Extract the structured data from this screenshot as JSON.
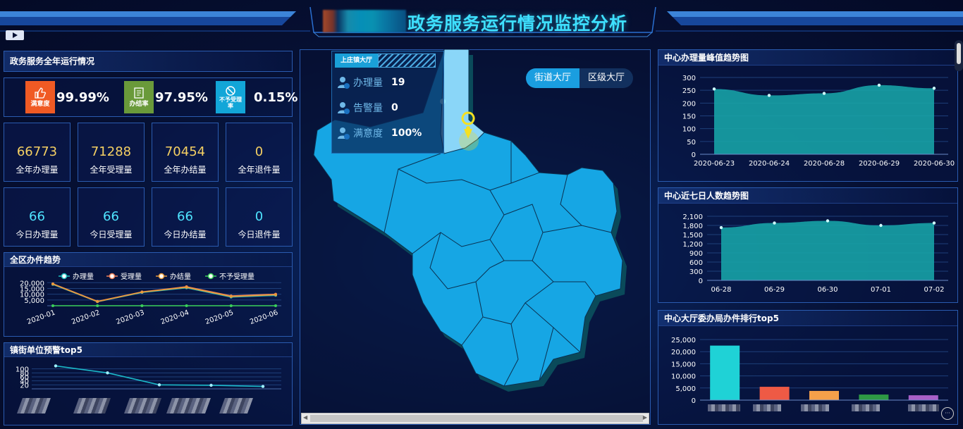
{
  "header": {
    "title": "政务服务运行情况监控分析"
  },
  "left": {
    "year_panel_title": "政务服务全年运行情况",
    "kpis": [
      {
        "label": "满意度",
        "value": "99.99%",
        "color": "#f05a24"
      },
      {
        "label": "办结率",
        "value": "97.95%",
        "color": "#6a9a3a"
      },
      {
        "label": "不予受理率",
        "value": "0.15%",
        "color": "#12a6d8"
      }
    ],
    "year_stats": [
      {
        "value": "66773",
        "label": "全年办理量"
      },
      {
        "value": "71288",
        "label": "全年受理量"
      },
      {
        "value": "70454",
        "label": "全年办结量"
      },
      {
        "value": "0",
        "label": "全年退件量"
      }
    ],
    "today_stats": [
      {
        "value": "66",
        "label": "今日办理量"
      },
      {
        "value": "66",
        "label": "今日受理量"
      },
      {
        "value": "66",
        "label": "今日办结量"
      },
      {
        "value": "0",
        "label": "今日退件量"
      }
    ],
    "trend_panel_title": "全区办件趋势",
    "trend_legend": [
      "办理量",
      "受理量",
      "办结量",
      "不予受理量"
    ],
    "trend_y_ticks": [
      "20,000",
      "15,000",
      "10,000",
      "5,000"
    ],
    "trend_x": [
      "2020-01",
      "2020-02",
      "2020-03",
      "2020-04",
      "2020-05",
      "2020-06"
    ],
    "warn_panel_title": "镇街单位预警top5",
    "warn_y_ticks": [
      "100",
      "80",
      "60",
      "40",
      "20"
    ]
  },
  "center": {
    "tabs": [
      "街道大厅",
      "区级大厅"
    ],
    "info_tag": "上庄镇大厅",
    "info_rows": [
      {
        "label": "办理量",
        "value": "19"
      },
      {
        "label": "告警量",
        "value": "0"
      },
      {
        "label": "满意度",
        "value": "100%"
      }
    ]
  },
  "right": {
    "peak_title": "中心办理量峰值趋势图",
    "peak_y_ticks": [
      "300",
      "250",
      "200",
      "150",
      "100",
      "50",
      "0"
    ],
    "peak_x": [
      "2020-06-23",
      "2020-06-24",
      "2020-06-28",
      "2020-06-29",
      "2020-06-30"
    ],
    "week_title": "中心近七日人数趋势图",
    "week_y_ticks": [
      "2,100",
      "1,800",
      "1,500",
      "1,200",
      "900",
      "600",
      "300",
      "0"
    ],
    "week_x": [
      "06-28",
      "06-29",
      "06-30",
      "07-01",
      "07-02"
    ],
    "rank_title": "中心大厅委办局办件排行top5",
    "rank_y_ticks": [
      "25,000",
      "20,000",
      "15,000",
      "10,000",
      "5,000",
      "0"
    ]
  },
  "chart_data": [
    {
      "type": "line",
      "title": "全区办件趋势",
      "categories": [
        "2020-01",
        "2020-02",
        "2020-03",
        "2020-04",
        "2020-05",
        "2020-06"
      ],
      "ylim": [
        0,
        22000
      ],
      "series": [
        {
          "name": "办理量",
          "values": [
            18500,
            3500,
            11500,
            15500,
            7500,
            9000
          ],
          "color": "#1bc0c0"
        },
        {
          "name": "受理量",
          "values": [
            19000,
            3800,
            12000,
            16500,
            8500,
            10000
          ],
          "color": "#f0825a"
        },
        {
          "name": "办结量",
          "values": [
            18800,
            3600,
            11800,
            16000,
            8000,
            9500
          ],
          "color": "#e89a3a"
        },
        {
          "name": "不予受理量",
          "values": [
            0,
            0,
            0,
            0,
            0,
            0
          ],
          "color": "#3ad05a"
        }
      ]
    },
    {
      "type": "line",
      "title": "镇街单位预警top5",
      "values": [
        115,
        80,
        20,
        18,
        12
      ],
      "ylim": [
        0,
        120
      ],
      "color": "#1bb8c8"
    },
    {
      "type": "area",
      "title": "中心办理量峰值趋势图",
      "categories": [
        "2020-06-23",
        "2020-06-24",
        "2020-06-28",
        "2020-06-29",
        "2020-06-30"
      ],
      "values": [
        255,
        230,
        238,
        270,
        258
      ],
      "ylim": [
        0,
        300
      ],
      "color": "#17a2a6"
    },
    {
      "type": "area",
      "title": "中心近七日人数趋势图",
      "categories": [
        "06-28",
        "06-29",
        "06-30",
        "07-01",
        "07-02"
      ],
      "values": [
        1730,
        1880,
        1950,
        1800,
        1880
      ],
      "ylim": [
        0,
        2100
      ],
      "color": "#17a2a6"
    },
    {
      "type": "bar",
      "title": "中心大厅委办局办件排行top5",
      "values": [
        22500,
        5500,
        3800,
        2300,
        2000
      ],
      "colors": [
        "#1fd2d6",
        "#ee5a45",
        "#f5a04a",
        "#2e9a44",
        "#a860c8"
      ],
      "ylim": [
        0,
        25000
      ]
    }
  ]
}
